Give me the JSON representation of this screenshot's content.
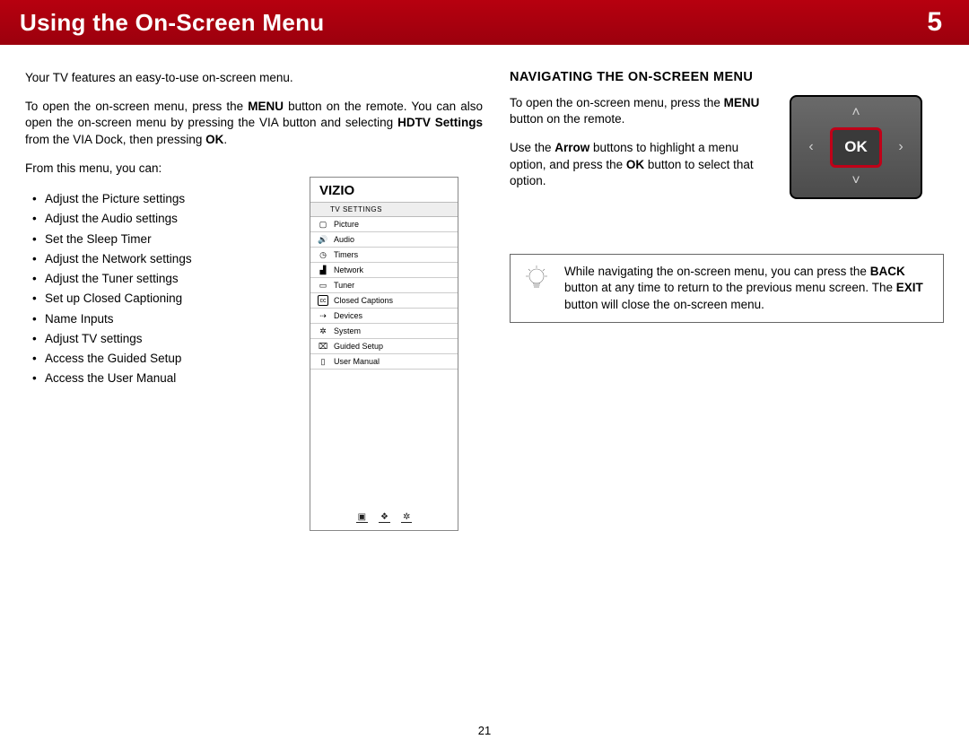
{
  "header": {
    "title": "Using the On-Screen Menu",
    "chapter": "5"
  },
  "page_number": "21",
  "left": {
    "p1": "Your TV features an easy-to-use on-screen menu.",
    "p2a": "To open the on-screen menu, press the ",
    "p2b": "MENU",
    "p2c": " button on the remote. You can also open the on-screen menu by pressing the VIA button and selecting ",
    "p2d": "HDTV Settings",
    "p2e": " from the VIA Dock, then pressing ",
    "p2f": "OK",
    "p2g": ".",
    "p3": "From this menu, you can:",
    "bullets": [
      "Adjust the Picture settings",
      "Adjust the Audio settings",
      "Set the Sleep Timer",
      "Adjust the Network settings",
      "Adjust the Tuner settings",
      "Set up Closed Captioning",
      "Name Inputs",
      "Adjust TV settings",
      "Access the Guided Setup",
      "Access the User Manual"
    ]
  },
  "tv_menu": {
    "brand": "VIZIO",
    "subhead": "TV SETTINGS",
    "rows": [
      {
        "icon": "▢",
        "label": "Picture"
      },
      {
        "icon": "🔊",
        "label": "Audio"
      },
      {
        "icon": "◷",
        "label": "Timers"
      },
      {
        "icon": "▟",
        "label": "Network"
      },
      {
        "icon": "▭",
        "label": "Tuner"
      },
      {
        "icon": "cc",
        "label": "Closed Captions"
      },
      {
        "icon": "⇢",
        "label": "Devices"
      },
      {
        "icon": "✲",
        "label": "System"
      },
      {
        "icon": "⌧",
        "label": "Guided Setup"
      },
      {
        "icon": "▯",
        "label": "User Manual"
      }
    ],
    "bottom": {
      "a": "▣",
      "b": "❖",
      "c": "✲"
    }
  },
  "right": {
    "heading": "NAVIGATING THE ON-SCREEN MENU",
    "p1a": "To open the on-screen menu, press the ",
    "p1b": "MENU",
    "p1c": " button on the remote.",
    "p2a": "Use the ",
    "p2b": "Arrow",
    "p2c": " buttons to highlight a menu option, and press the ",
    "p2d": "OK",
    "p2e": " button to select that option.",
    "dpad": {
      "ok": "OK",
      "up": "˄",
      "down": "˅",
      "left": "‹",
      "right": "›"
    },
    "tip_a": "While navigating the on-screen menu, you can press the ",
    "tip_b": "BACK",
    "tip_c": " button at any time to return to the previous menu screen. The ",
    "tip_d": "EXIT",
    "tip_e": " button will close the on-screen menu."
  }
}
